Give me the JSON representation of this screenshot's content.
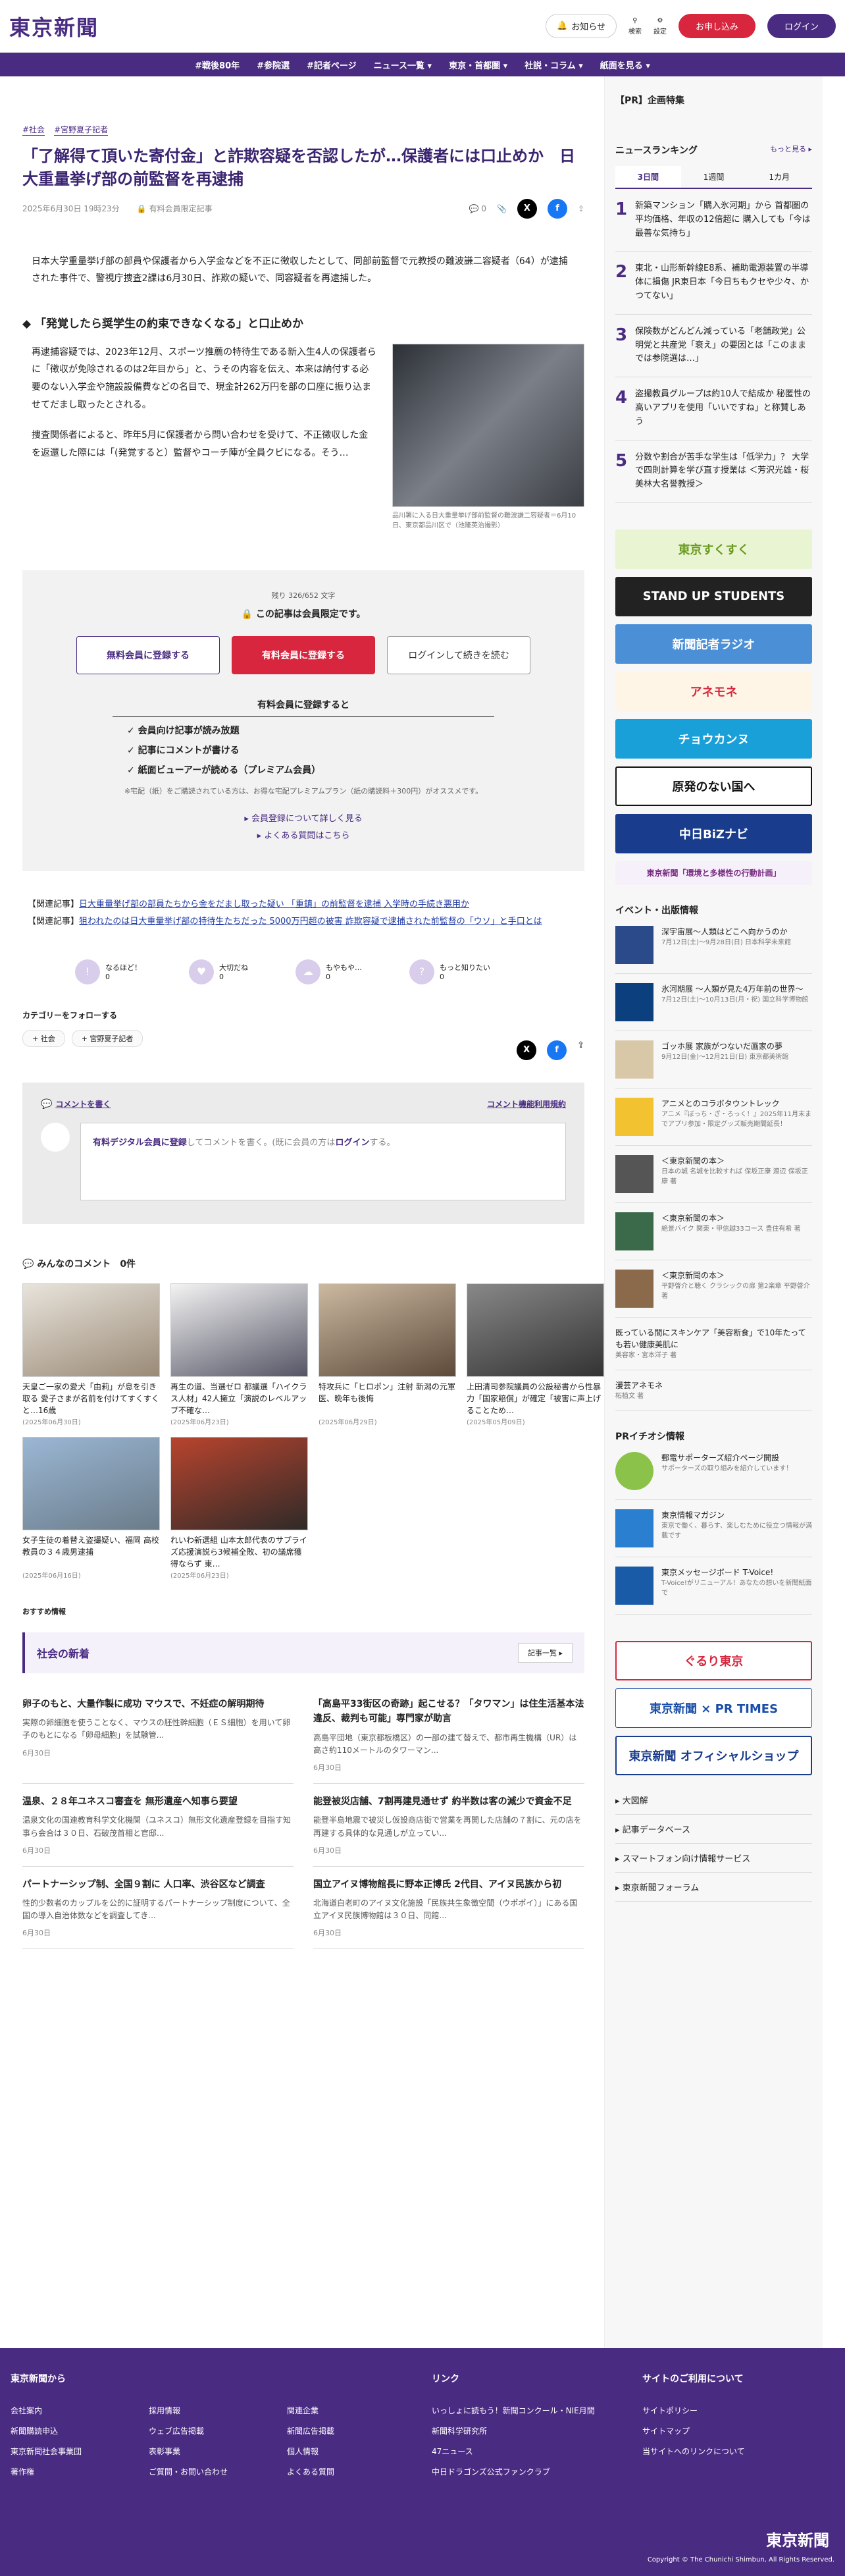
{
  "header": {
    "logo": "東京新聞",
    "notice": "お知らせ",
    "search": "検索",
    "settings": "設定",
    "register": "お申し込み",
    "login": "ログイン"
  },
  "nav": [
    "#戦後80年",
    "#参院選",
    "#記者ページ",
    "ニュース一覧 ▾",
    "東京・首都圏 ▾",
    "社説・コラム ▾",
    "紙面を見る ▾"
  ],
  "article": {
    "tags": [
      "#社会",
      "#宮野夏子記者"
    ],
    "title": "「了解得て頂いた寄付金」と詐欺容疑を否認したが…保護者には口止めか　日大重量挙げ部の前監督を再逮捕",
    "date": "2025年6月30日 19時23分",
    "badge": "有料会員限定記事",
    "comment_count": "0",
    "lead": "日本大学重量挙げ部の部員や保護者から入学金などを不正に徴収したとして、同部前監督で元教授の難波謙二容疑者（64）が逮捕された事件で、警視庁捜査2課は6月30日、詐欺の疑いで、同容疑者を再逮捕した。",
    "subhead": "「発覚したら奨学生の約束できなくなる」と口止めか",
    "p1": "再逮捕容疑では、2023年12月、スポーツ推薦の特待生である新入生4人の保護者らに「徴収が免除されるのは2年目から」と、うその内容を伝え、本来は納付する必要のない入学金や施設設備費などの名目で、現金計262万円を部の口座に振り込ませてだまし取ったとされる。",
    "p2": "捜査関係者によると、昨年5月に保護者から問い合わせを受けて、不正徴収した金を返還した際には「(発覚すると）監督やコーチ陣が全員クビになる。そう…",
    "caption": "品川署に入る日大重量挙げ部前監督の難波謙二容疑者＝6月10日、東京都品川区で（池隆英治撮影）"
  },
  "paywall": {
    "remaining": "残り 326/652 文字",
    "msg": "この記事は会員限定です。",
    "free": "無料会員に登録する",
    "paid": "有料会員に登録する",
    "login": "ログインして続きを読む",
    "btitle": "有料会員に登録すると",
    "benefits": [
      "会員向け記事が読み放題",
      "記事にコメントが書ける",
      "紙面ビューアーが読める（プレミアム会員）"
    ],
    "note": "※宅配（紙）をご購読されている方は、お得な宅配プレミアムプラン（紙の購読料＋300円）がオススメです。",
    "link1": "▸ 会員登録について詳しく見る",
    "link2": "▸ よくある質問はこちら"
  },
  "related": [
    {
      "label": "【関連記事】",
      "text": "日大重量挙げ部の部員たちから金をだまし取った疑い 「重鎮」の前監督を逮捕 入学時の手続き悪用か"
    },
    {
      "label": "【関連記事】",
      "text": "狙われたのは日大重量挙げ部の特待生たちだった 5000万円超の被害 詐欺容疑で逮捕された前監督の「ウソ」と手口とは"
    }
  ],
  "reactions": [
    {
      "label": "なるほど！",
      "n": "0"
    },
    {
      "label": "大切だね",
      "n": "0"
    },
    {
      "label": "もやもや…",
      "n": "0"
    },
    {
      "label": "もっと知りたい",
      "n": "0"
    }
  ],
  "follow": {
    "title": "カテゴリーをフォローする",
    "tags": [
      "+ 社会",
      "+ 宮野夏子記者"
    ]
  },
  "comment": {
    "title": "コメントを書く",
    "rules": "コメント機能利用規約",
    "pre": "有料デジタル会員に登録",
    "mid": "してコメントを書く。(既に会員の方は",
    "login": "ログイン",
    "post": "する。"
  },
  "minna": {
    "title": "みんなのコメント",
    "count": "0件"
  },
  "grid": [
    {
      "t": "天皇ご一家の愛犬「由莉」が息を引き取る 愛子さまが名前を付けてすくすくと…16歳",
      "d": "(2025年06月30日)"
    },
    {
      "t": "再生の道、当選ゼロ 都議選「ハイクラス人材」42人擁立「演説のレベルアップ不確な…",
      "d": "(2025年06月23日)"
    },
    {
      "t": "特攻兵に「ヒロポン」注射 新潟の元軍医、晩年も後悔",
      "d": "(2025年06月29日)"
    },
    {
      "t": "上田清司参院議員の公設秘書から性暴力「国家賠償」が確定「被害に声上げることため…",
      "d": "(2025年05月09日)"
    },
    {
      "t": "女子生徒の着替え盗撮疑い、福岡 高校教員の３４歳男逮捕",
      "d": "(2025年06月16日)"
    },
    {
      "t": "れいわ新選組 山本太郎代表のサプライズ応援演説ら3候補全敗、初の議席獲得ならず 東…",
      "d": "(2025年06月23日)"
    }
  ],
  "rec": "おすすめ情報",
  "shinsin": {
    "title": "社会の新着",
    "more": "記事一覧 ▸"
  },
  "news": [
    {
      "h": "卵子のもと、大量作製に成功 マウスで、不妊症の解明期待",
      "b": "実際の卵細胞を使うことなく、マウスの胚性幹細胞（ＥＳ細胞）を用いて卵子のもとになる「卵母細胞」を試験管...",
      "d": "6月30日"
    },
    {
      "h": "「高島平33街区の奇跡」起こせる？「タワマン」は住生活基本法違反、裁判も可能」専門家が助言",
      "b": "高島平団地（東京都板橋区）の一部の建て替えで、都市再生機構（UR）は高さ約110メートルのタワーマン...",
      "d": "6月30日"
    },
    {
      "h": "温泉、２８年ユネスコ審査を 無形遺産へ知事ら要望",
      "b": "温泉文化の国連教育科学文化機関（ユネスコ）無形文化遺産登録を目指す知事ら会合は３０日、石破茂首相と官邸...",
      "d": "6月30日"
    },
    {
      "h": "能登被災店舗、7割再建見通せず 約半数は客の減少で資金不足",
      "b": "能登半島地震で被災し仮設商店街で営業を再開した店舗の７割に、元の店を再建する具体的な見通しが立ってい...",
      "d": "6月30日"
    },
    {
      "h": "パートナーシップ制、全国９割に 人口率、渋谷区など調査",
      "b": "性的少数者のカップルを公的に証明するパートナーシップ制度について、全国の導入自治体数などを調査してき...",
      "d": "6月30日"
    },
    {
      "h": "国立アイヌ博物館長に野本正博氏 2代目、アイヌ民族から初",
      "b": "北海道白老町のアイヌ文化施設「民族共生象徴空間（ウポポイ）」にある国立アイヌ民族博物館は３０日、同館...",
      "d": "6月30日"
    }
  ],
  "side": {
    "pr": "【PR】企画特集",
    "rank_title": "ニュースランキング",
    "rank_more": "もっと見る ▸",
    "tabs": [
      "3日間",
      "1週間",
      "1カ月"
    ],
    "rank": [
      {
        "n": "1",
        "t": "新築マンション「購入氷河期」から 首都圏の平均価格、年収の12倍超に 購入しても「今は最善な気持ち」"
      },
      {
        "n": "2",
        "t": "東北・山形新幹線E8系、補助電源装置の半導体に損傷 JR東日本「今日ちもクセや少々、かつてない」"
      },
      {
        "n": "3",
        "t": "保険数がどんどん減っている「老舗政党」公明党と共産党「衰え」の要因とは「このままでは参院選は…」"
      },
      {
        "n": "4",
        "t": "盗撮教員グループは約10人で結成か 秘匿性の高いアプリを使用「いいですね」と称賛しあう"
      },
      {
        "n": "5",
        "t": "分数や割合が苦手な学生は「低学力」？ 大学で四則計算を学び直す授業は ＜芳沢光雄・桜美林大名誉教授＞"
      }
    ],
    "banners": [
      "東京すくすく",
      "STAND UP STUDENTS",
      "新聞記者ラジオ",
      "アネモネ",
      "チョウカンヌ",
      "原発のない国へ",
      "中日BiZナビ",
      "東京新聞「環境と多様性の行動計画」"
    ],
    "ev_title": "イベント・出版情報",
    "events": [
      {
        "t": "深宇宙展〜人類はどこへ向かうのか",
        "s": "7月12日(土)〜9月28日(日) 日本科学未来館"
      },
      {
        "t": "氷河期展 〜人類が見た4万年前の世界〜",
        "s": "7月12日(土)〜10月13日(月・祝) 国立科学博物館"
      },
      {
        "t": "ゴッホ展 家族がつないだ画家の夢",
        "s": "9月12日(金)〜12月21日(日) 東京都美術館"
      },
      {
        "t": "アニメとのコラボタウントレック",
        "s": "アニメ『ぼっち・ざ・ろっく！』2025年11月末までアプリ参加・限定グッズ販売期間延長！"
      },
      {
        "t": "＜東京新聞の本＞",
        "s": "日本の城 名城を比較すれば 保坂正康 渡辺 保坂正康 著"
      },
      {
        "t": "＜東京新聞の本＞",
        "s": "絶景バイク 関東・甲信越33コース 豊住有希 著"
      },
      {
        "t": "＜東京新聞の本＞",
        "s": "平野啓介と聴く クラシックの扉 第2楽章 平野啓介 著"
      },
      {
        "t": "既っている間にスキンケア「美容断食」で10年たっても若い健康美肌に",
        "s": "美容家・宮本洋子 著"
      },
      {
        "t": "漫芸アネモネ",
        "s": "柘植文 著"
      }
    ],
    "pri_title": "PRイチオシ情報",
    "pri": [
      {
        "t": "郵電サポーターズ紹介ページ開設",
        "s": "サポーターズの取り組みを紹介しています！"
      },
      {
        "t": "東京情報マガジン",
        "s": "東京で働く、暮らす、楽しむために役立つ情報が満載です"
      },
      {
        "t": "東京メッセージボード T-Voice!",
        "s": "T-Voice!がリニューアル！あなたの想いを新聞紙面で"
      }
    ],
    "pbanners": [
      "ぐるり東京",
      "東京新聞 × PR TIMES",
      "東京新聞 オフィシャルショップ"
    ],
    "slinks": [
      "▸ 大図解",
      "▸ 記事データベース",
      "▸ スマートフォン向け情報サービス",
      "▸ 東京新聞フォーラム"
    ]
  },
  "footer": {
    "c1": "東京新聞から",
    "c2": "リンク",
    "c3": "サイトのご利用について",
    "l1": [
      "会社案内",
      "採用情報",
      "関連企業",
      "新聞購読申込",
      "ウェブ広告掲載",
      "新聞広告掲載",
      "東京新聞社会事業団",
      "表彰事業",
      "個人情報",
      "著作権",
      "ご質問・お問い合わせ",
      "よくある質問"
    ],
    "l2": [
      "いっしょに読もう！新聞コンクール・NIE月間",
      "新聞科学研究所",
      "47ニュース",
      "中日ドラゴンズ公式ファンクラブ"
    ],
    "l3": [
      "サイトポリシー",
      "サイトマップ",
      "当サイトへのリンクについて"
    ],
    "logo": "東京新聞",
    "copy": "Copyright © The Chunichi Shimbun, All Rights Reserved."
  },
  "colors": {
    "brand": "#4a2b82",
    "red": "#d7263d"
  }
}
